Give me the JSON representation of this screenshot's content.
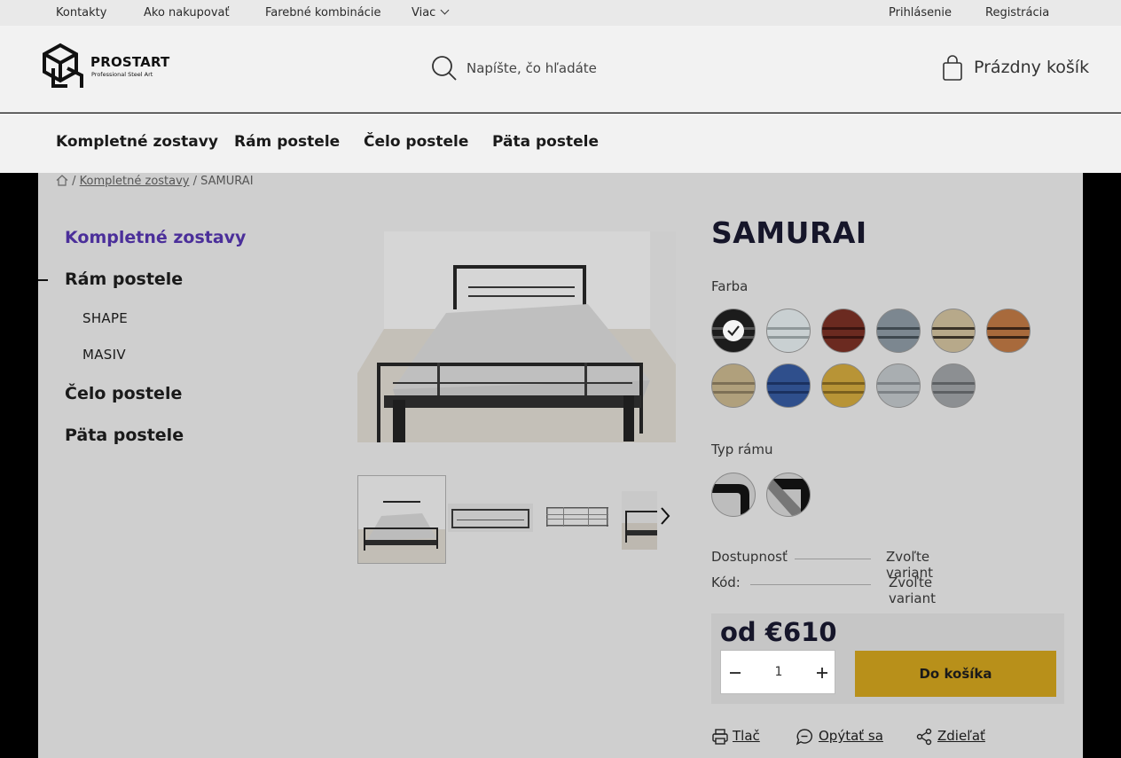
{
  "topbar": {
    "links": [
      "Kontakty",
      "Ako nakupovať",
      "Farebné kombinácie",
      "Viac"
    ],
    "login": "Prihlásenie",
    "register": "Registrácia"
  },
  "header": {
    "brand": "PROSTART",
    "tagline": "Professional Steel Art",
    "search_placeholder": "Napíšte, čo hľadáte",
    "cart_label": "Prázdny košík"
  },
  "nav": [
    "Kompletné zostavy",
    "Rám postele",
    "Čelo postele",
    "Päta postele"
  ],
  "breadcrumb": {
    "sep": "/",
    "category": "Kompletné zostavy",
    "current": "SAMURAI"
  },
  "sidebar": {
    "categories": [
      "Kompletné zostavy",
      "Rám postele",
      "Čelo postele",
      "Päta postele"
    ],
    "subcategories": [
      "SHAPE",
      "MASIV"
    ]
  },
  "product": {
    "title": "SAMURAI",
    "color_label": "Farba",
    "colors": [
      {
        "name": "black",
        "base": "#1c1c1c",
        "stripe": "#555555",
        "selected": true
      },
      {
        "name": "light-grey",
        "base": "#c9d0d2",
        "stripe": "#8f989a",
        "selected": false
      },
      {
        "name": "brown-red",
        "base": "#6b2a20",
        "stripe": "#3a1410",
        "selected": false
      },
      {
        "name": "grey-blue",
        "base": "#7c8790",
        "stripe": "#3f4950",
        "selected": false
      },
      {
        "name": "beige",
        "base": "#b7a98a",
        "stripe": "#3a3328",
        "selected": false
      },
      {
        "name": "copper",
        "base": "#a86a3c",
        "stripe": "#3a2416",
        "selected": false
      },
      {
        "name": "sand",
        "base": "#b0a07c",
        "stripe": "#7d7056",
        "selected": false
      },
      {
        "name": "blue",
        "base": "#2f4f8c",
        "stripe": "#1b3160",
        "selected": false
      },
      {
        "name": "gold",
        "base": "#b89436",
        "stripe": "#7a5f1e",
        "selected": false
      },
      {
        "name": "silver",
        "base": "#a9aeb1",
        "stripe": "#7d8286",
        "selected": false
      },
      {
        "name": "graphite",
        "base": "#8c8f92",
        "stripe": "#5d6063",
        "selected": false
      }
    ],
    "frame_label": "Typ rámu",
    "availability_label": "Dostupnosť",
    "availability_value": "Zvoľte variant",
    "code_label": "Kód:",
    "code_value": "Zvoľte variant",
    "price": "od €610",
    "quantity": "1",
    "add_to_cart": "Do košíka"
  },
  "actions": [
    "Tlač",
    "Opýtať sa",
    "Zdieľať"
  ]
}
